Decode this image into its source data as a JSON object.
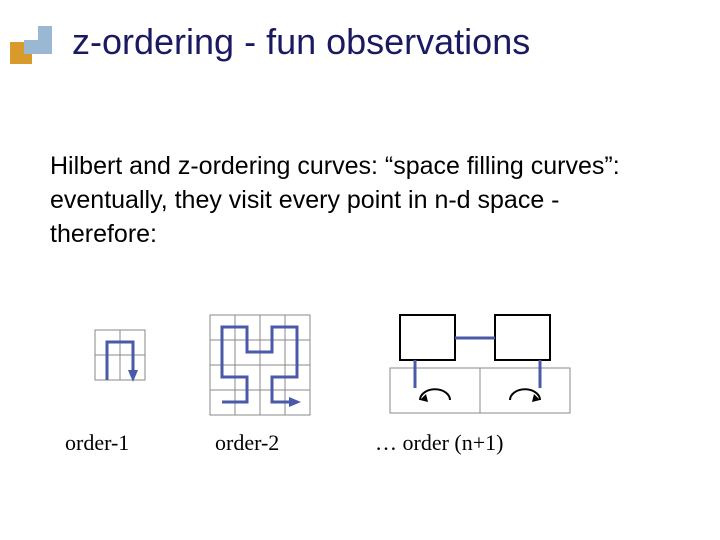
{
  "title": "z-ordering - fun observations",
  "body": "Hilbert and z-ordering curves: “space filling curves”: eventually, they visit every point in n-d space - therefore:",
  "labels": {
    "order1": "order-1",
    "order2": "order-2",
    "orderN": "… order (n+1)"
  }
}
